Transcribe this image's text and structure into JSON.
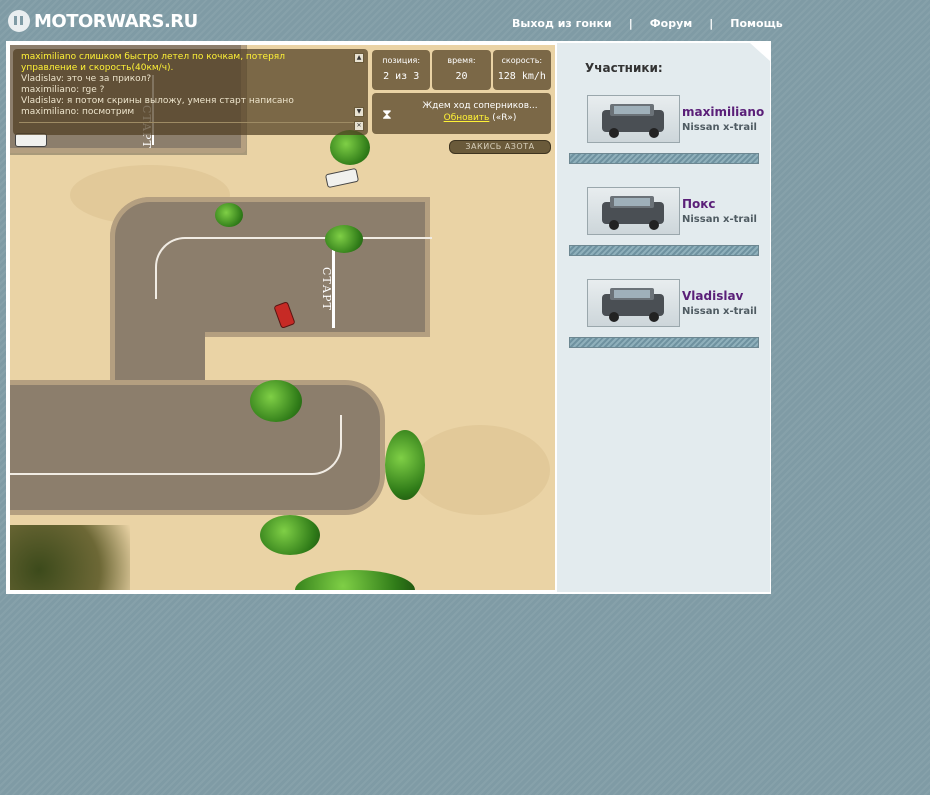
{
  "site": {
    "logo_text": "MOTORWARS.RU"
  },
  "nav": {
    "items": [
      {
        "label": "Выход из гонки"
      },
      {
        "label": "Форум"
      },
      {
        "label": "Помощь"
      }
    ],
    "separator": "|"
  },
  "chat": {
    "messages": [
      {
        "text": "maximiliano слишком быстро летел по кочкам, потерял управление и скорость(40км/ч).",
        "highlight": true
      },
      {
        "text": "Vladislav: это че за прикол?",
        "highlight": false
      },
      {
        "text": "maximiliano: rge ?",
        "highlight": false
      },
      {
        "text": "Vladislav: я потом скрины выложу, уменя старт написано",
        "highlight": false
      },
      {
        "text": "maximiliano: посмотрим",
        "highlight": false
      }
    ]
  },
  "stats": {
    "position_label": "позиция:",
    "position_value": "2 из 3",
    "time_label": "время:",
    "time_value": "20",
    "speed_label": "скорость:",
    "speed_value": "128 km/h"
  },
  "waiting": {
    "text": "Ждем ход соперников...",
    "refresh_label": "Обновить",
    "refresh_hint": "(«R»)"
  },
  "nitro_label": "ЗАКИСЬ АЗОТА",
  "track": {
    "start_label": "СТАРТ"
  },
  "participants_title": "Участники:",
  "participants": [
    {
      "name": "maximiliano",
      "car": "Nissan x-trail"
    },
    {
      "name": "Покс",
      "car": "Nissan x-trail"
    },
    {
      "name": "Vladislav",
      "car": "Nissan x-trail"
    }
  ],
  "colors": {
    "background": "#7f9ba5",
    "sand": "#ead3a5",
    "road": "#8c7e6c",
    "participant_name": "#5a1f78",
    "chat_highlight": "#fff236"
  }
}
